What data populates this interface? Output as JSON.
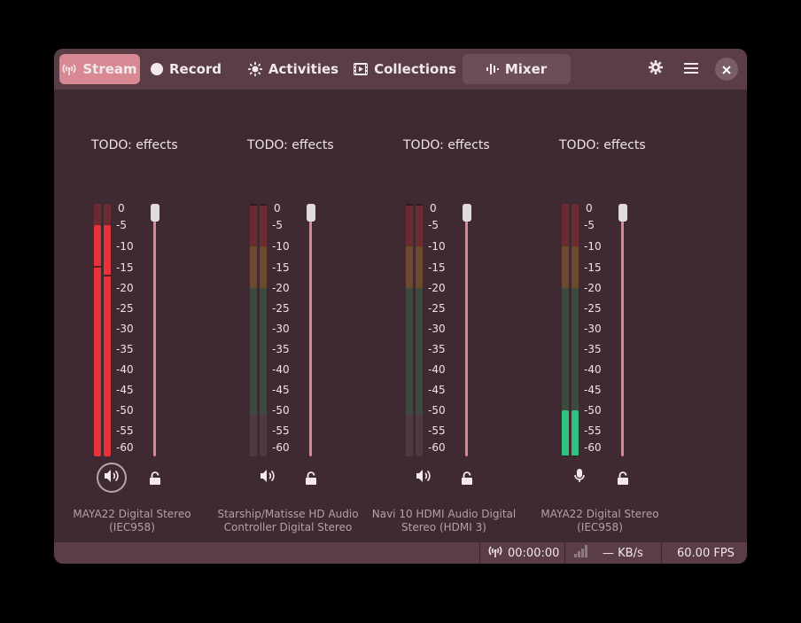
{
  "header": {
    "tabs": [
      {
        "label": "Stream",
        "icon": "antenna-icon"
      },
      {
        "label": "Record",
        "icon": "record-dot-icon"
      },
      {
        "label": "Activities",
        "icon": "sun-icon"
      },
      {
        "label": "Collections",
        "icon": "film-icon"
      },
      {
        "label": "Mixer",
        "icon": "equalizer-icon"
      }
    ],
    "active_tab": "Stream",
    "selected_tab": "Mixer"
  },
  "scale_labels": [
    "0",
    "-5",
    "-10",
    "-15",
    "-20",
    "-25",
    "-30",
    "-35",
    "-40",
    "-45",
    "-50",
    "-55",
    "-60"
  ],
  "strips": [
    {
      "effects": "TODO: effects",
      "device": "MAYA22 Digital Stereo (IEC958)",
      "icon": "speaker-icon",
      "level_db": [
        -5,
        -5
      ],
      "peak_db": [
        -15,
        -17
      ],
      "color": "#e8323a",
      "active": true
    },
    {
      "effects": "TODO: effects",
      "device": "Starship/Matisse HD Audio Controller Digital Stereo",
      "icon": "speaker-icon",
      "level_db": [
        -60,
        -60
      ],
      "peak_db": [
        0,
        0
      ],
      "color": "#e8323a",
      "active": false
    },
    {
      "effects": "TODO: effects",
      "device": "Navi 10 HDMI Audio Digital Stereo (HDMI 3)",
      "icon": "speaker-icon",
      "level_db": [
        -60,
        -60
      ],
      "peak_db": [
        0,
        0
      ],
      "color": "#e8323a",
      "active": false
    },
    {
      "effects": "TODO: effects",
      "device": "MAYA22 Digital Stereo (IEC958)",
      "icon": "microphone-icon",
      "level_db": [
        -49,
        -49
      ],
      "peak_db": [
        -60,
        -60
      ],
      "color": "#2ec27e",
      "active": false
    }
  ],
  "status": {
    "time": "00:00:00",
    "rate": "— KB/s",
    "fps": "60.00 FPS"
  }
}
